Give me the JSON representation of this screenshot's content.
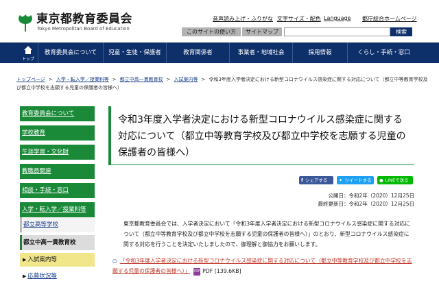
{
  "header": {
    "title": "東京都教育委員会",
    "subtitle": "Tokyo Metropolitan Board of Education",
    "util_links": [
      "音声読み上げ・ふりがな",
      "文字サイズ・配色",
      "Language",
      "都庁総合ホームページ"
    ],
    "lang_button": "このサイトの使い方",
    "sitemap_button": "サイトマップ",
    "search_placeholder": "",
    "search_button": "検索"
  },
  "gnav": {
    "home_label": "トップ",
    "items": [
      "教育委員会について",
      "児童・生徒・保護者",
      "教育関係者",
      "事業者・地域社会",
      "採用情報",
      "くらし・手続・窓口"
    ]
  },
  "breadcrumb": {
    "items": [
      "トップページ",
      "入学・転入学／授業料等",
      "都立中高一貫教育校",
      "入試案内等"
    ],
    "current": "令和3年度入学者決定における新型コロナウイルス感染症に関する対応について（都立中等教育学校及び都立中学校を志願する児童の保護者の皆様へ）"
  },
  "sidebar": {
    "items": [
      "教育委員会について",
      "学校教育",
      "生涯学習・文化財",
      "教職員関連",
      "相談・手続・窓口",
      "入学・転入学／授業料等"
    ],
    "subsections": [
      "都立高等学校",
      "都立中高一貫教育校"
    ],
    "subitems": [
      "入試案内等",
      "応募状況等"
    ]
  },
  "main": {
    "title": "令和3年度入学者決定における新型コロナウイルス感染症に関する対応について（都立中等教育学校及び都立中学校を志願する児童の保護者の皆様へ）",
    "share_facebook": "シェアする",
    "share_twitter": "ツイートする",
    "share_line": "LINEで送る",
    "published": "公開日：令和2年（2020）12月25日",
    "updated": "最終更新日：令和2年（2020）12月25日",
    "body": "東京都教育委員会では、入学者決定において「令和3年度入学者決定における新型コロナウイルス感染症に関する対応について（都立中等教育学校及び都立中学校を志願する児童の保護者の皆様へ）」のとおり、新型コロナウイルス感染症に関する対応を行うことを決定いたしましたので、御理解と御協力をお願いします。",
    "bullet": "○",
    "document_link": "「令和3年度入学者決定における新型コロナウイルス感染症に関する対応について（都立中等教育学校及び都立中学校を志願する児童の保護者の皆様へ）」",
    "pdf_icon_label": "PDF",
    "document_meta": "PDF [139.6KB]"
  },
  "colors": {
    "nav_blue": "#0d2f6a",
    "sidebar_green": "#1a8a39",
    "link_red": "#c0392b",
    "active_yellow": "#f1e68a"
  },
  "icons": [
    "ginkgo-logo-icon",
    "home-icon",
    "facebook-icon",
    "twitter-icon",
    "line-icon",
    "pdf-icon"
  ]
}
